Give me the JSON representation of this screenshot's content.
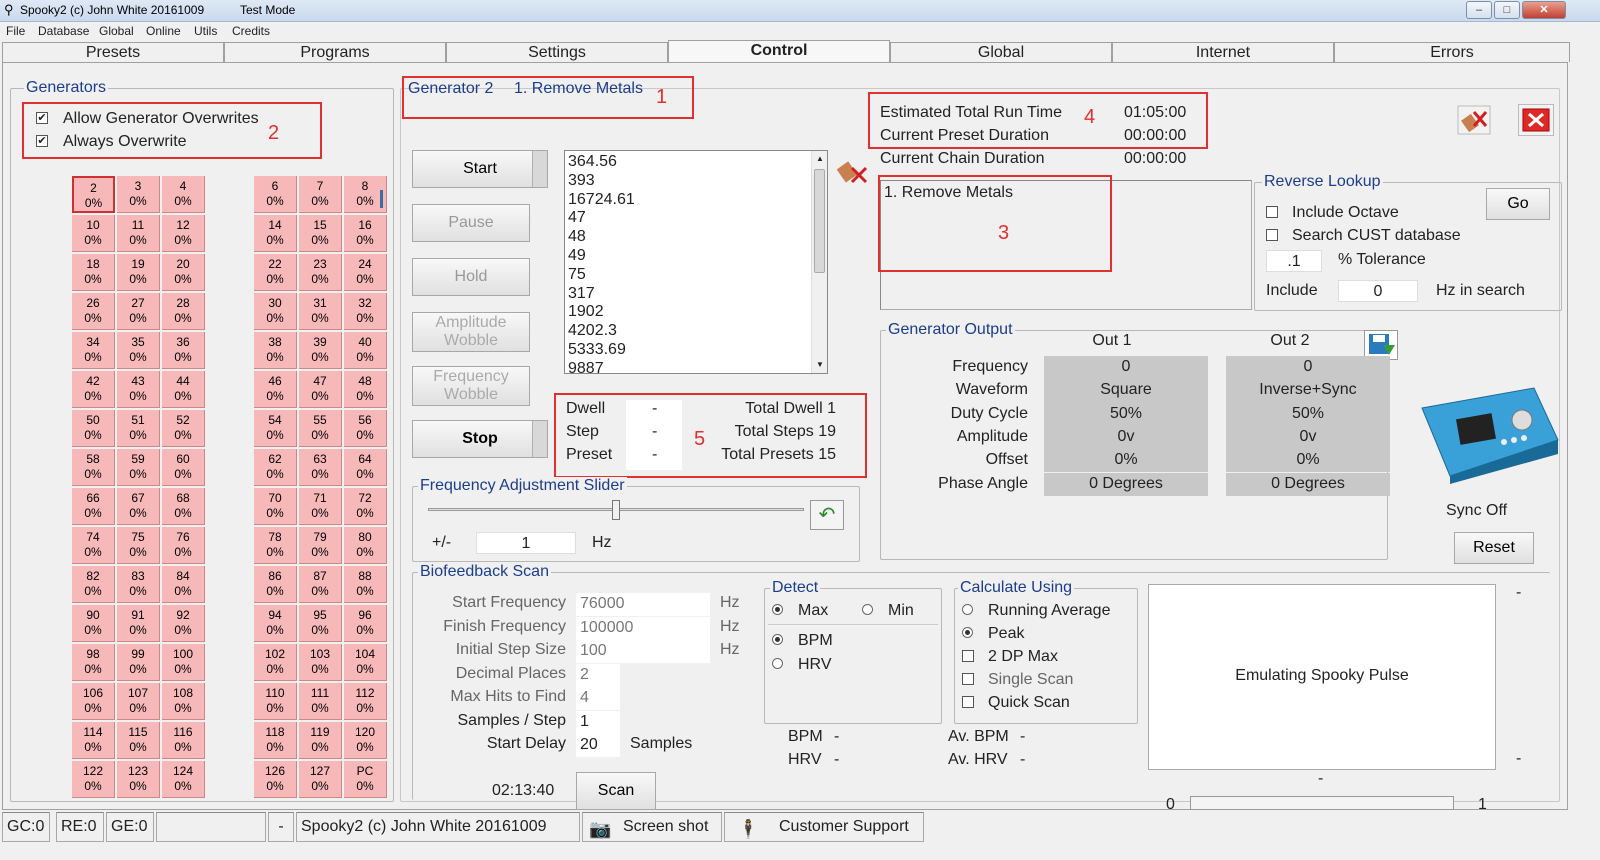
{
  "window": {
    "title": "Spooky2 (c) John White 20161009",
    "mode": "Test Mode"
  },
  "menu": [
    "File",
    "Database",
    "Global",
    "Online",
    "Utils",
    "Credits"
  ],
  "tabs": [
    "Presets",
    "Programs",
    "Settings",
    "Control",
    "Global",
    "Internet",
    "Errors"
  ],
  "generators": {
    "legend": "Generators",
    "allow_overwrites": "Allow Generator Overwrites",
    "always_overwrite": "Always Overwrite",
    "left_cells": [
      [
        "2",
        "0%"
      ],
      [
        "3",
        "0%"
      ],
      [
        "4",
        "0%"
      ],
      [
        "10",
        "0%"
      ],
      [
        "11",
        "0%"
      ],
      [
        "12",
        "0%"
      ],
      [
        "18",
        "0%"
      ],
      [
        "19",
        "0%"
      ],
      [
        "20",
        "0%"
      ],
      [
        "26",
        "0%"
      ],
      [
        "27",
        "0%"
      ],
      [
        "28",
        "0%"
      ],
      [
        "34",
        "0%"
      ],
      [
        "35",
        "0%"
      ],
      [
        "36",
        "0%"
      ],
      [
        "42",
        "0%"
      ],
      [
        "43",
        "0%"
      ],
      [
        "44",
        "0%"
      ],
      [
        "50",
        "0%"
      ],
      [
        "51",
        "0%"
      ],
      [
        "52",
        "0%"
      ],
      [
        "58",
        "0%"
      ],
      [
        "59",
        "0%"
      ],
      [
        "60",
        "0%"
      ],
      [
        "66",
        "0%"
      ],
      [
        "67",
        "0%"
      ],
      [
        "68",
        "0%"
      ],
      [
        "74",
        "0%"
      ],
      [
        "75",
        "0%"
      ],
      [
        "76",
        "0%"
      ],
      [
        "82",
        "0%"
      ],
      [
        "83",
        "0%"
      ],
      [
        "84",
        "0%"
      ],
      [
        "90",
        "0%"
      ],
      [
        "91",
        "0%"
      ],
      [
        "92",
        "0%"
      ],
      [
        "98",
        "0%"
      ],
      [
        "99",
        "0%"
      ],
      [
        "100",
        "0%"
      ],
      [
        "106",
        "0%"
      ],
      [
        "107",
        "0%"
      ],
      [
        "108",
        "0%"
      ],
      [
        "114",
        "0%"
      ],
      [
        "115",
        "0%"
      ],
      [
        "116",
        "0%"
      ],
      [
        "122",
        "0%"
      ],
      [
        "123",
        "0%"
      ],
      [
        "124",
        "0%"
      ]
    ],
    "right_cells": [
      [
        "6",
        "0%"
      ],
      [
        "7",
        "0%"
      ],
      [
        "8",
        "0%"
      ],
      [
        "14",
        "0%"
      ],
      [
        "15",
        "0%"
      ],
      [
        "16",
        "0%"
      ],
      [
        "22",
        "0%"
      ],
      [
        "23",
        "0%"
      ],
      [
        "24",
        "0%"
      ],
      [
        "30",
        "0%"
      ],
      [
        "31",
        "0%"
      ],
      [
        "32",
        "0%"
      ],
      [
        "38",
        "0%"
      ],
      [
        "39",
        "0%"
      ],
      [
        "40",
        "0%"
      ],
      [
        "46",
        "0%"
      ],
      [
        "47",
        "0%"
      ],
      [
        "48",
        "0%"
      ],
      [
        "54",
        "0%"
      ],
      [
        "55",
        "0%"
      ],
      [
        "56",
        "0%"
      ],
      [
        "62",
        "0%"
      ],
      [
        "63",
        "0%"
      ],
      [
        "64",
        "0%"
      ],
      [
        "70",
        "0%"
      ],
      [
        "71",
        "0%"
      ],
      [
        "72",
        "0%"
      ],
      [
        "78",
        "0%"
      ],
      [
        "79",
        "0%"
      ],
      [
        "80",
        "0%"
      ],
      [
        "86",
        "0%"
      ],
      [
        "87",
        "0%"
      ],
      [
        "88",
        "0%"
      ],
      [
        "94",
        "0%"
      ],
      [
        "95",
        "0%"
      ],
      [
        "96",
        "0%"
      ],
      [
        "102",
        "0%"
      ],
      [
        "103",
        "0%"
      ],
      [
        "104",
        "0%"
      ],
      [
        "110",
        "0%"
      ],
      [
        "111",
        "0%"
      ],
      [
        "112",
        "0%"
      ],
      [
        "118",
        "0%"
      ],
      [
        "119",
        "0%"
      ],
      [
        "120",
        "0%"
      ],
      [
        "126",
        "0%"
      ],
      [
        "127",
        "0%"
      ],
      [
        "PC",
        "0%"
      ]
    ]
  },
  "control": {
    "generator": "Generator 2",
    "program": "1. Remove Metals",
    "buttons": {
      "start": "Start",
      "pause": "Pause",
      "hold": "Hold",
      "amp_wobble": "Amplitude Wobble",
      "freq_wobble": "Frequency Wobble",
      "stop": "Stop"
    },
    "freqs": [
      "364.56",
      "393",
      "16724.61",
      "47",
      "48",
      "49",
      "75",
      "317",
      "1902",
      "4202.3",
      "5333.69",
      "9887"
    ],
    "dwell": {
      "dwell_label": "Dwell",
      "dwell_val": "-",
      "total_dwell": "Total Dwell 1",
      "step_label": "Step",
      "step_val": "-",
      "total_steps": "Total Steps 19",
      "preset_label": "Preset",
      "preset_val": "-",
      "total_presets": "Total Presets 15"
    },
    "times": {
      "total_run_label": "Estimated Total Run Time",
      "total_run": "01:05:00",
      "preset_dur_label": "Current Preset Duration",
      "preset_dur": "00:00:00",
      "chain_dur_label": "Current Chain Duration",
      "chain_dur": "00:00:00"
    },
    "program_box": "1. Remove Metals",
    "annotations": [
      "1",
      "2",
      "3",
      "4",
      "5"
    ]
  },
  "reverse": {
    "legend": "Reverse Lookup",
    "include_octave": "Include Octave",
    "search_cust": "Search CUST database",
    "tolerance_val": ".1",
    "tolerance_label": "% Tolerance",
    "include_label": "Include",
    "include_val": "0",
    "hz_label": "Hz in search",
    "go": "Go"
  },
  "slider": {
    "legend": "Frequency Adjustment Slider",
    "pm": "+/-",
    "value": "1",
    "unit": "Hz",
    "position": 0.5
  },
  "output": {
    "legend": "Generator Output",
    "col1": "Out 1",
    "col2": "Out 2",
    "rows": [
      [
        "Frequency",
        "0",
        "0"
      ],
      [
        "Waveform",
        "Square",
        "Inverse+Sync"
      ],
      [
        "Duty Cycle",
        "50%",
        "50%"
      ],
      [
        "Amplitude",
        "0v",
        "0v"
      ],
      [
        "Offset",
        "0%",
        "0%"
      ],
      [
        "Phase Angle",
        "0 Degrees",
        "0 Degrees"
      ]
    ]
  },
  "device": {
    "sync": "Sync Off",
    "reset": "Reset"
  },
  "bio": {
    "legend": "Biofeedback Scan",
    "fields": [
      [
        "Start Frequency",
        "76000",
        "Hz"
      ],
      [
        "Finish Frequency",
        "100000",
        "Hz"
      ],
      [
        "Initial Step Size",
        "100",
        "Hz"
      ],
      [
        "Decimal Places",
        "2",
        ""
      ],
      [
        "Max Hits to Find",
        "4",
        ""
      ],
      [
        "Samples / Step",
        "1",
        ""
      ],
      [
        "Start Delay",
        "20",
        "Samples"
      ]
    ],
    "time": "02:13:40",
    "scan": "Scan",
    "detect": {
      "legend": "Detect",
      "max": "Max",
      "min": "Min",
      "bpm": "BPM",
      "hrv": "HRV"
    },
    "calc": {
      "legend": "Calculate Using",
      "running": "Running Average",
      "peak": "Peak",
      "dp2": "2 DP Max",
      "single": "Single Scan",
      "quick": "Quick Scan"
    },
    "readout": {
      "bpm": "BPM",
      "bpm_val": "-",
      "hrv": "HRV",
      "hrv_val": "-",
      "avbpm": "Av. BPM",
      "avbpm_val": "-",
      "avhrv": "Av. HRV",
      "avhrv_val": "-"
    },
    "graph_text": "Emulating Spooky Pulse",
    "dash": "-",
    "progress_min": "0",
    "progress_max": "1"
  },
  "statusbar": {
    "gc": "GC:0",
    "re": "RE:0",
    "ge": "GE:0",
    "dash": "-",
    "title": "Spooky2 (c) John White 20161009",
    "screenshot": "Screen shot",
    "support": "Customer Support"
  }
}
